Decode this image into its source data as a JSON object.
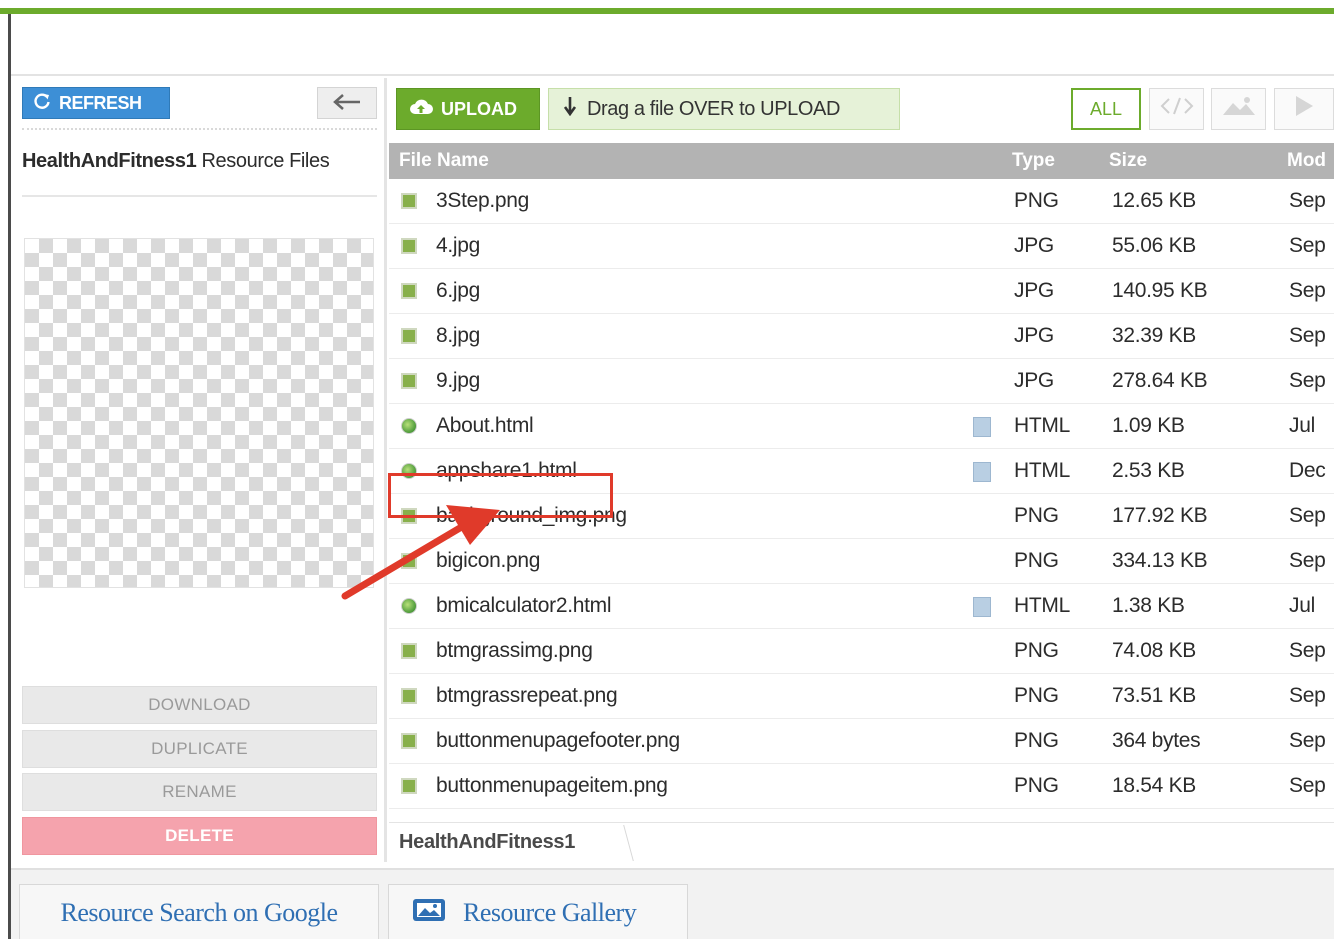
{
  "toolbar": {
    "refresh_label": "REFRESH",
    "upload_label": "UPLOAD",
    "drag_label": "Drag a file OVER to UPLOAD",
    "filter_all_label": "ALL"
  },
  "sidebar": {
    "site_name": "HealthAndFitness1",
    "site_suffix": "Resource Files",
    "actions": {
      "download": "DOWNLOAD",
      "duplicate": "DUPLICATE",
      "rename": "RENAME",
      "delete": "DELETE"
    }
  },
  "table": {
    "columns": {
      "name": "File Name",
      "type": "Type",
      "size": "Size",
      "modified": "Mod"
    },
    "rows": [
      {
        "name": "3Step.png",
        "type": "PNG",
        "size": "12.65 KB",
        "modified": "Sep",
        "kind": "image"
      },
      {
        "name": "4.jpg",
        "type": "JPG",
        "size": "55.06 KB",
        "modified": "Sep",
        "kind": "image"
      },
      {
        "name": "6.jpg",
        "type": "JPG",
        "size": "140.95 KB",
        "modified": "Sep",
        "kind": "image"
      },
      {
        "name": "8.jpg",
        "type": "JPG",
        "size": "32.39 KB",
        "modified": "Sep",
        "kind": "image"
      },
      {
        "name": "9.jpg",
        "type": "JPG",
        "size": "278.64 KB",
        "modified": "Sep",
        "kind": "image"
      },
      {
        "name": "About.html",
        "type": "HTML",
        "size": "1.09 KB",
        "modified": "Jul",
        "kind": "html"
      },
      {
        "name": "appshare1.html",
        "type": "HTML",
        "size": "2.53 KB",
        "modified": "Dec",
        "kind": "html"
      },
      {
        "name": "background_img.png",
        "type": "PNG",
        "size": "177.92 KB",
        "modified": "Sep",
        "kind": "image"
      },
      {
        "name": "bigicon.png",
        "type": "PNG",
        "size": "334.13 KB",
        "modified": "Sep",
        "kind": "image"
      },
      {
        "name": "bmicalculator2.html",
        "type": "HTML",
        "size": "1.38 KB",
        "modified": "Jul",
        "kind": "html"
      },
      {
        "name": "btmgrassimg.png",
        "type": "PNG",
        "size": "74.08 KB",
        "modified": "Sep",
        "kind": "image"
      },
      {
        "name": "btmgrassrepeat.png",
        "type": "PNG",
        "size": "73.51 KB",
        "modified": "Sep",
        "kind": "image"
      },
      {
        "name": "buttonmenupagefooter.png",
        "type": "PNG",
        "size": "364 bytes",
        "modified": "Sep",
        "kind": "image"
      },
      {
        "name": "buttonmenupageitem.png",
        "type": "PNG",
        "size": "18.54 KB",
        "modified": "Sep",
        "kind": "image"
      }
    ]
  },
  "breadcrumb": {
    "current": "HealthAndFitness1"
  },
  "bottom_tabs": {
    "google": "Resource Search on Google",
    "gallery": "Resource Gallery"
  },
  "annotation": {
    "highlight_color": "#e03a2a"
  },
  "colors": {
    "accent_green": "#6cab2c",
    "refresh_blue": "#3d8fd6",
    "delete_pink": "#f5a3ad",
    "header_gray": "#b3b3b3"
  }
}
